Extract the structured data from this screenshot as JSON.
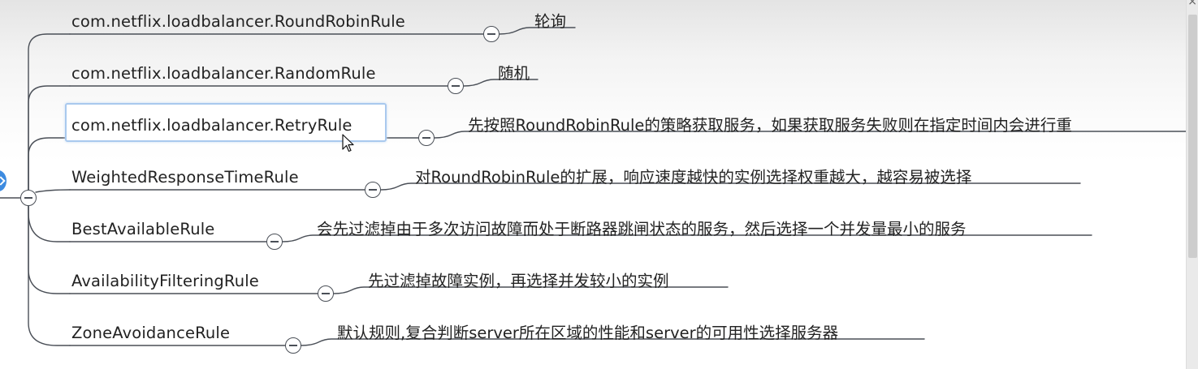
{
  "nodes": [
    {
      "id": "n1",
      "label": "com.netflix.loadbalancer.RoundRobinRule",
      "note": "轮询",
      "selected": false
    },
    {
      "id": "n2",
      "label": "com.netflix.loadbalancer.RandomRule",
      "note": "随机",
      "selected": false
    },
    {
      "id": "n3",
      "label": "com.netflix.loadbalancer.RetryRule",
      "note": "先按照RoundRobinRule的策略获取服务，如果获取服务失败则在指定时间内会进行重",
      "selected": true
    },
    {
      "id": "n4",
      "label": "WeightedResponseTimeRule",
      "note": "对RoundRobinRule的扩展，响应速度越快的实例选择权重越大，越容易被选择",
      "selected": false
    },
    {
      "id": "n5",
      "label": "BestAvailableRule",
      "note": "会先过滤掉由于多次访问故障而处于断路器跳闸状态的服务，然后选择一个并发量最小的服务",
      "selected": false
    },
    {
      "id": "n6",
      "label": "AvailabilityFilteringRule",
      "note": "先过滤掉故障实例，再选择并发较小的实例",
      "selected": false
    },
    {
      "id": "n7",
      "label": "ZoneAvoidanceRule",
      "note": "默认规则,复合判断server所在区域的性能和server的可用性选择服务器",
      "selected": false
    }
  ],
  "colors": {
    "connector": "#4a4f57",
    "selection_border": "#a9c9ee",
    "expander": "#3d8be0"
  },
  "icons": {
    "collapse": "minus-circle-icon",
    "expand_tab": "chevron-left-icon",
    "cursor": "mouse-pointer-icon",
    "window_close": "close-icon"
  }
}
